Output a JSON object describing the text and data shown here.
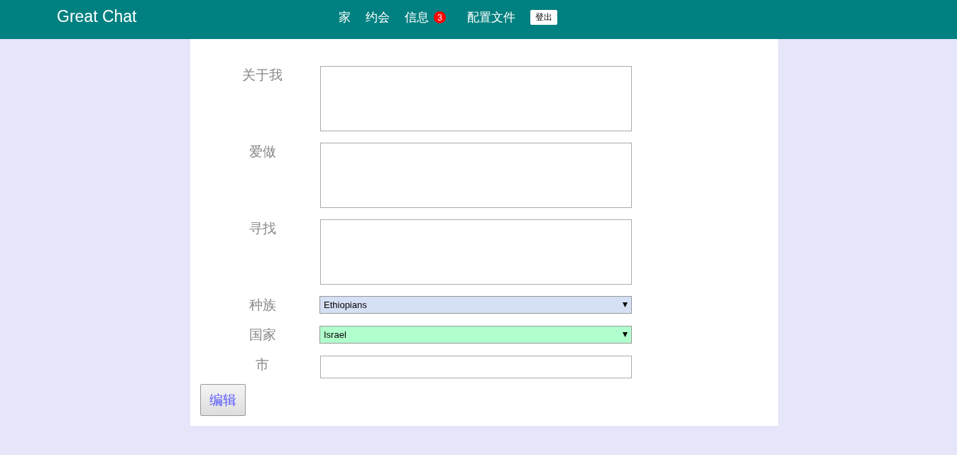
{
  "header": {
    "brand": "Great Chat",
    "nav": [
      {
        "kind": "link",
        "label": "家"
      },
      {
        "kind": "link",
        "label": "约会"
      },
      {
        "kind": "link",
        "label": "信息",
        "badge": "3"
      },
      {
        "kind": "link",
        "label": "配置文件"
      },
      {
        "kind": "button",
        "label": "登出"
      }
    ]
  },
  "form": {
    "fields": [
      {
        "kind": "textarea",
        "label": "关于我"
      },
      {
        "kind": "textarea",
        "label": "爱做"
      },
      {
        "kind": "textarea",
        "label": "寻找"
      },
      {
        "kind": "select",
        "label": "种族",
        "value": "Ethiopians",
        "color": "#d6e0f5"
      },
      {
        "kind": "select",
        "label": "国家",
        "value": "Israel",
        "color": "#b0ffcc"
      },
      {
        "kind": "input",
        "label": "市"
      }
    ],
    "submit": "编辑"
  }
}
